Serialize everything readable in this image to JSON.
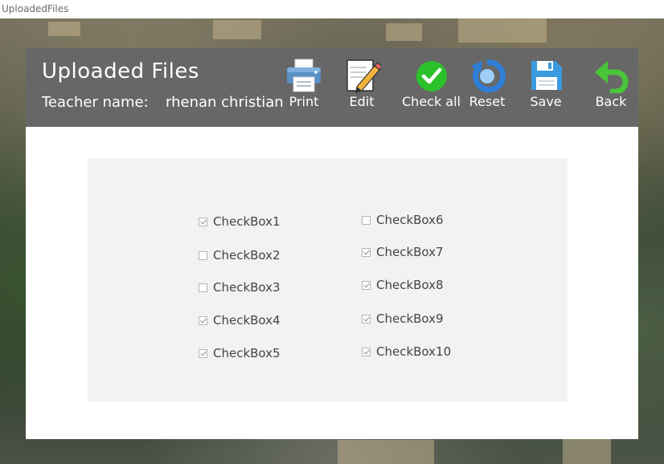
{
  "window": {
    "title": "UploadedFiles"
  },
  "header": {
    "title": "Uploaded Files",
    "teacher_label": "Teacher name:",
    "teacher_name": "rhenan christian"
  },
  "toolbar": {
    "print": {
      "label": "Print",
      "icon": "printer-icon"
    },
    "edit": {
      "label": "Edit",
      "icon": "edit-pencil-icon"
    },
    "check_all": {
      "label": "Check all",
      "icon": "check-circle-icon"
    },
    "reset": {
      "label": "Reset",
      "icon": "reset-arrow-icon"
    },
    "save": {
      "label": "Save",
      "icon": "floppy-disk-icon"
    },
    "back": {
      "label": "Back",
      "icon": "back-arrow-icon"
    }
  },
  "checkboxes": [
    {
      "label": "CheckBox1",
      "checked": true
    },
    {
      "label": "CheckBox2",
      "checked": false
    },
    {
      "label": "CheckBox3",
      "checked": false
    },
    {
      "label": "CheckBox4",
      "checked": true
    },
    {
      "label": "CheckBox5",
      "checked": true
    },
    {
      "label": "CheckBox6",
      "checked": false
    },
    {
      "label": "CheckBox7",
      "checked": true
    },
    {
      "label": "CheckBox8",
      "checked": true
    },
    {
      "label": "CheckBox9",
      "checked": true
    },
    {
      "label": "CheckBox10",
      "checked": true
    }
  ],
  "colors": {
    "header_bg": "#676767",
    "panel_bg": "#f2f2f2",
    "check_green": "#2bc12b",
    "reset_blue": "#2f7fd6",
    "save_blue": "#3a9be0",
    "back_green": "#49c53a"
  }
}
